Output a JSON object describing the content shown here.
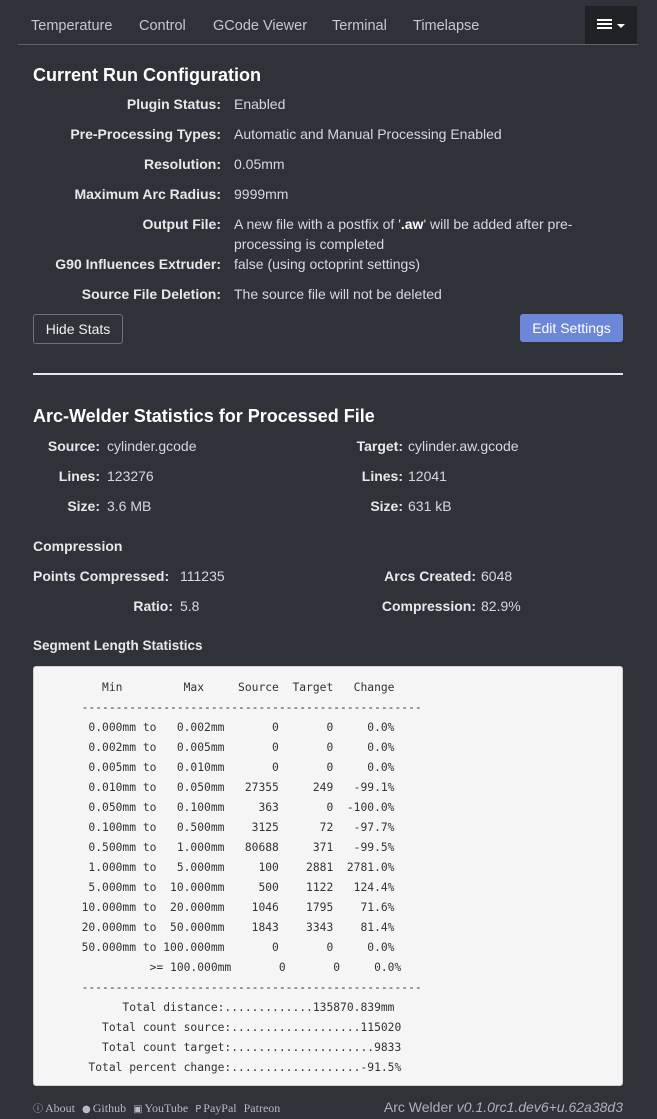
{
  "tabs": [
    "Temperature",
    "Control",
    "GCode Viewer",
    "Terminal",
    "Timelapse"
  ],
  "config": {
    "title": "Current Run Configuration",
    "rows": [
      {
        "label": "Plugin Status:",
        "value": "Enabled"
      },
      {
        "label": "Pre-Processing Types:",
        "value": "Automatic and Manual Processing Enabled"
      },
      {
        "label": "Resolution:",
        "value": "0.05mm"
      },
      {
        "label": "Maximum Arc Radius:",
        "value": "9999mm"
      },
      {
        "label": "Output File:",
        "value_pre": "A new file with a postfix of '",
        "value_bold": ".aw",
        "value_post": "' will be added after pre-processing is completed"
      },
      {
        "label": "G90 Influences Extruder:",
        "value": "false (using octoprint settings)"
      },
      {
        "label": "Source File Deletion:",
        "value": "The source file will not be deleted"
      }
    ],
    "hide_stats_label": "Hide Stats",
    "edit_settings_label": "Edit Settings"
  },
  "stats": {
    "title": "Arc-Welder Statistics for Processed File",
    "source": {
      "label": "Source:",
      "value": "cylinder.gcode"
    },
    "target": {
      "label": "Target:",
      "value": "cylinder.aw.gcode"
    },
    "source_lines": {
      "label": "Lines:",
      "value": "123276"
    },
    "target_lines": {
      "label": "Lines:",
      "value": "12041"
    },
    "source_size": {
      "label": "Size:",
      "value": "3.6 MB"
    },
    "target_size": {
      "label": "Size:",
      "value": "631 kB"
    },
    "compression_heading": "Compression",
    "points_compressed": {
      "label": "Points Compressed:",
      "value": "111235"
    },
    "arcs_created": {
      "label": "Arcs Created:",
      "value": "6048"
    },
    "ratio": {
      "label": "Ratio:",
      "value": "5.8"
    },
    "compression": {
      "label": "Compression:",
      "value": "82.9%"
    },
    "segment_heading": "Segment Length Statistics",
    "segment_table": [
      "          Min         Max     Source  Target   Change",
      "       --------------------------------------------------",
      "        0.000mm to   0.002mm       0       0     0.0%",
      "        0.002mm to   0.005mm       0       0     0.0%",
      "        0.005mm to   0.010mm       0       0     0.0%",
      "        0.010mm to   0.050mm   27355     249   -99.1%",
      "        0.050mm to   0.100mm     363       0  -100.0%",
      "        0.100mm to   0.500mm    3125      72   -97.7%",
      "        0.500mm to   1.000mm   80688     371   -99.5%",
      "        1.000mm to   5.000mm     100    2881  2781.0%",
      "        5.000mm to  10.000mm     500    1122   124.4%",
      "       10.000mm to  20.000mm    1046    1795    71.6%",
      "       20.000mm to  50.000mm    1843    3343    81.4%",
      "       50.000mm to 100.000mm       0       0     0.0%",
      "                 >= 100.000mm       0       0     0.0%",
      "       --------------------------------------------------",
      "             Total distance:.............135870.839mm",
      "          Total count source:...................115020",
      "          Total count target:.....................9833",
      "        Total percent change:...................-91.5%"
    ]
  },
  "footer": {
    "links": [
      {
        "icon": "info-icon",
        "glyph": "ⓘ",
        "label": "About"
      },
      {
        "icon": "github-icon",
        "glyph": "●",
        "label": "Github"
      },
      {
        "icon": "youtube-icon",
        "glyph": "▣",
        "label": "YouTube"
      },
      {
        "icon": "paypal-icon",
        "glyph": "P",
        "label": "PayPal"
      },
      {
        "icon": "",
        "glyph": "",
        "label": "Patreon"
      }
    ],
    "version_name": "Arc Welder",
    "version_number": "v0.1.0rc1.dev6+u.62a38d3"
  }
}
